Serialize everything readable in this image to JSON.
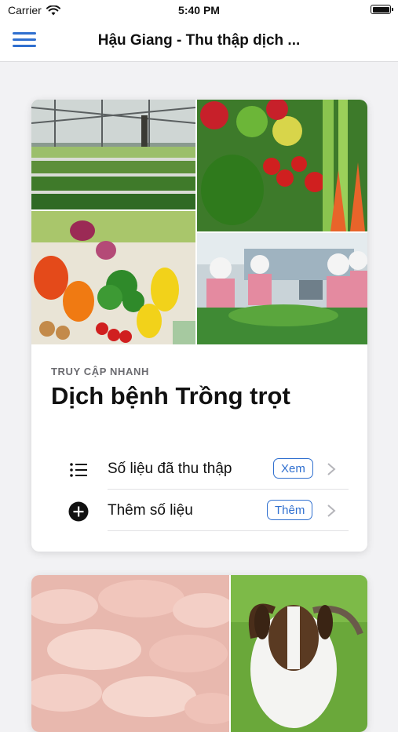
{
  "status_bar": {
    "carrier": "Carrier",
    "time": "5:40 PM"
  },
  "nav": {
    "title": "Hậu Giang - Thu thập dịch ...",
    "menu_icon": "hamburger-menu-icon"
  },
  "cards": [
    {
      "section_label": "TRUY CẬP NHANH",
      "title": "Dịch bệnh Trồng trọt",
      "actions": [
        {
          "icon": "list-icon",
          "label": "Số liệu đã thu thập",
          "badge": "Xem"
        },
        {
          "icon": "plus-circle-icon",
          "label": "Thêm số liệu",
          "badge": "Thêm"
        }
      ]
    }
  ],
  "colors": {
    "accent": "#2f6fcf",
    "background": "#f2f2f4",
    "card": "#ffffff"
  }
}
